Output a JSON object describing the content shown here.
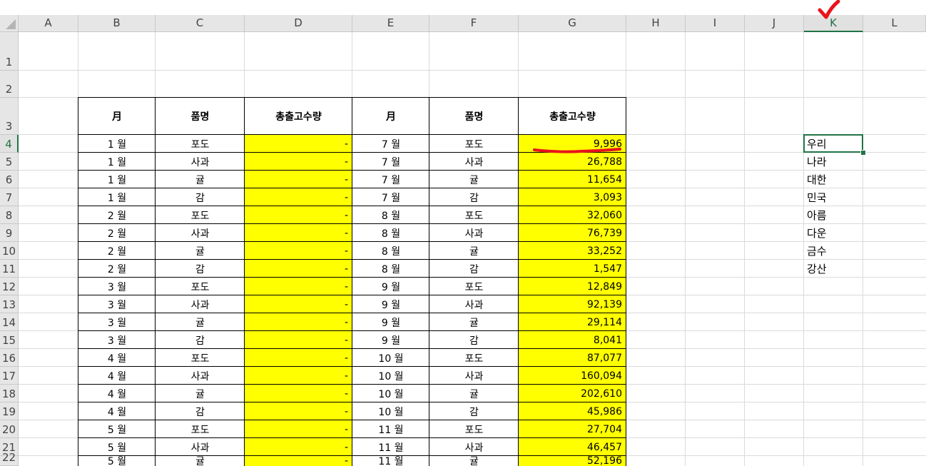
{
  "sheet": {
    "columns": [
      "A",
      "B",
      "C",
      "D",
      "E",
      "F",
      "G",
      "H",
      "I",
      "J",
      "K",
      "L"
    ],
    "selected_column": "K",
    "rows": [
      "1",
      "2",
      "3",
      "4",
      "5",
      "6",
      "7",
      "8",
      "9",
      "10",
      "11",
      "12",
      "13",
      "14",
      "15",
      "16",
      "17",
      "18",
      "19",
      "20",
      "21",
      "22"
    ],
    "selected_row": "4"
  },
  "table": {
    "headers": [
      "月",
      "품명",
      "총출고수량",
      "月",
      "품명",
      "총출고수량"
    ],
    "rows": [
      [
        "1 월",
        "포도",
        "-",
        "7 월",
        "포도",
        "9,996"
      ],
      [
        "1 월",
        "사과",
        "-",
        "7 월",
        "사과",
        "26,788"
      ],
      [
        "1 월",
        "귤",
        "-",
        "7 월",
        "귤",
        "11,654"
      ],
      [
        "1 월",
        "감",
        "-",
        "7 월",
        "감",
        "3,093"
      ],
      [
        "2 월",
        "포도",
        "-",
        "8 월",
        "포도",
        "32,060"
      ],
      [
        "2 월",
        "사과",
        "-",
        "8 월",
        "사과",
        "76,739"
      ],
      [
        "2 월",
        "귤",
        "-",
        "8 월",
        "귤",
        "33,252"
      ],
      [
        "2 월",
        "감",
        "-",
        "8 월",
        "감",
        "1,547"
      ],
      [
        "3 월",
        "포도",
        "-",
        "9 월",
        "포도",
        "12,849"
      ],
      [
        "3 월",
        "사과",
        "-",
        "9 월",
        "사과",
        "92,139"
      ],
      [
        "3 월",
        "귤",
        "-",
        "9 월",
        "귤",
        "29,114"
      ],
      [
        "3 월",
        "감",
        "-",
        "9 월",
        "감",
        "8,041"
      ],
      [
        "4 월",
        "포도",
        "-",
        "10 월",
        "포도",
        "87,077"
      ],
      [
        "4 월",
        "사과",
        "-",
        "10 월",
        "사과",
        "160,094"
      ],
      [
        "4 월",
        "귤",
        "-",
        "10 월",
        "귤",
        "202,610"
      ],
      [
        "4 월",
        "감",
        "-",
        "10 월",
        "감",
        "45,986"
      ],
      [
        "5 월",
        "포도",
        "-",
        "11 월",
        "포도",
        "27,704"
      ],
      [
        "5 월",
        "사과",
        "-",
        "11 월",
        "사과",
        "46,457"
      ],
      [
        "5 월",
        "귤",
        "-",
        "11 월",
        "귤",
        "52,196"
      ]
    ]
  },
  "k_column": [
    "우리",
    "나라",
    "대한",
    "민국",
    "아름",
    "다운",
    "금수",
    "강산"
  ],
  "colors": {
    "highlight": "#ffff00",
    "selection": "#217346",
    "annotation": "#e8141c",
    "header_bg": "#e6e6e6",
    "gridline": "#dadada"
  },
  "annotations": [
    "checkmark-over-column-K",
    "red-underline-under-G4"
  ]
}
